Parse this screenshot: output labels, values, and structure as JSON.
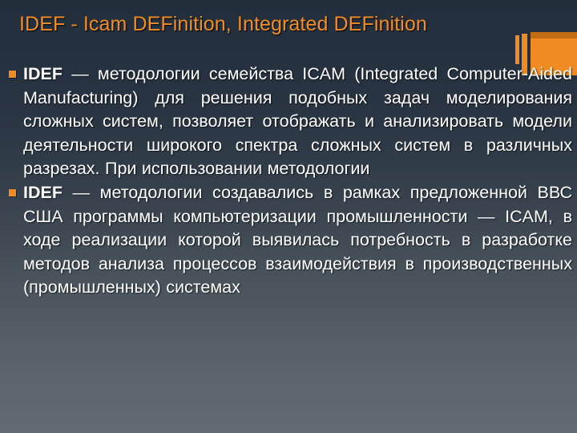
{
  "slide": {
    "title": "IDEF - Icam DEFinition, Integrated DEFinition",
    "title_color": "#f08c22",
    "background_top_color": "#222e3a",
    "background_bottom_color": "#626a72",
    "accent_color": "#ef8b22",
    "body_text_color": "#ffffff",
    "bullets": [
      {
        "marker": "orange-square-bullet",
        "lead": "IDEF",
        "text": " — методологии семейства ICAM (Integrated Computer-Aided Manufacturing) для решения подобных задач моделирования сложных систем, позволяет отображать и анализировать модели деятельности широкого спектра сложных систем в различных разрезах. При использовании методологии"
      },
      {
        "marker": "orange-square-bullet",
        "lead": "IDEF",
        "text": " — методологии создавались в рамках предложенной ВВС США программы компьютеризации промышленности — ICAM, в ходе реализации которой выявилась потребность в разработке методов анализа процессов взаимодействия в производственных (промышленных) системах"
      }
    ]
  }
}
